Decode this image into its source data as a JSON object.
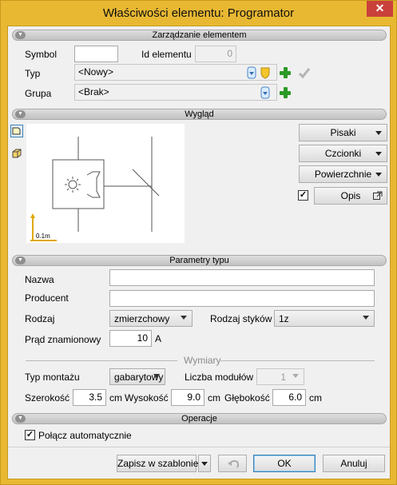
{
  "window": {
    "title": "Właściwości elementu: Programator",
    "close": "✕"
  },
  "sections": {
    "manage": "Zarządzanie elementem",
    "appearance": "Wygląd",
    "type_params": "Parametry typu",
    "operations": "Operacje"
  },
  "element": {
    "symbol_label": "Symbol",
    "symbol_value": "",
    "id_label": "Id elementu",
    "id_value": "0",
    "type_label": "Typ",
    "type_value": "<Nowy>",
    "group_label": "Grupa",
    "group_value": "<Brak>"
  },
  "appearance": {
    "pens": "Pisaki",
    "fonts": "Czcionki",
    "surfaces": "Powierzchnie",
    "description": "Opis",
    "description_checked": true,
    "scale": "0.1m"
  },
  "params": {
    "name_label": "Nazwa",
    "name_value": "",
    "producer_label": "Producent",
    "producer_value": "",
    "kind_label": "Rodzaj",
    "kind_value": "zmierzchowy",
    "contact_label": "Rodzaj styków",
    "contact_value": "1z",
    "current_label": "Prąd znamionowy",
    "current_value": "10",
    "current_unit": "A"
  },
  "dims": {
    "header": "Wymiary",
    "mount_label": "Typ montażu",
    "mount_value": "gabarytowy",
    "modules_label": "Liczba modułów",
    "modules_value": "1",
    "width_label": "Szerokość",
    "width_value": "3.5",
    "height_label": "Wysokość",
    "height_value": "9.0",
    "depth_label": "Głębokość",
    "depth_value": "6.0",
    "unit": "cm"
  },
  "ops": {
    "auto_connect": "Połącz automatycznie",
    "auto_connect_checked": true
  },
  "footer": {
    "save_template": "Zapisz w szablonie",
    "ok": "OK",
    "cancel": "Anuluj"
  }
}
